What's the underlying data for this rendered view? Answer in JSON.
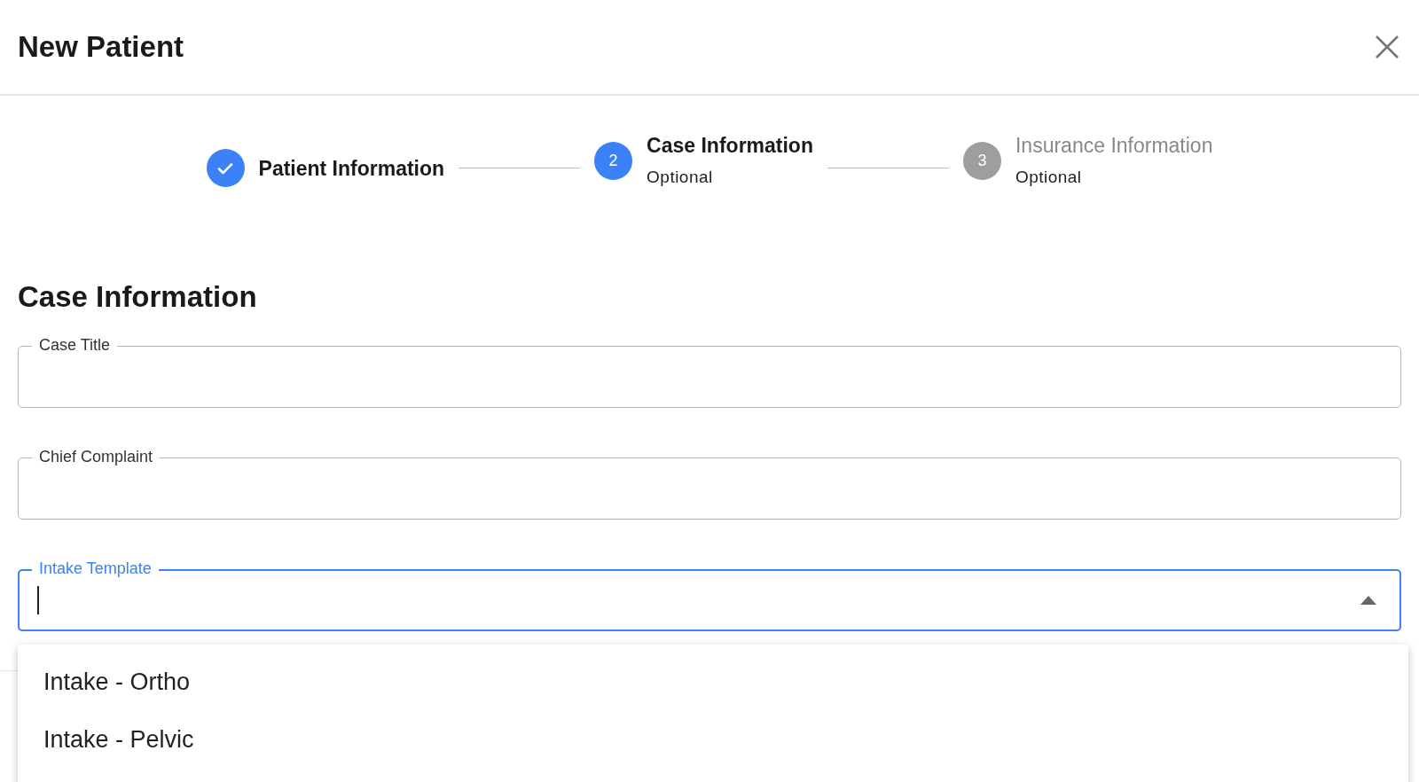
{
  "dialog": {
    "title": "New Patient"
  },
  "stepper": [
    {
      "label": "Patient Information",
      "completed": true,
      "selected": false
    },
    {
      "label": "Case Information",
      "number": "2",
      "caption": "Optional",
      "completed": false,
      "selected": true
    },
    {
      "label": "Insurance Information",
      "number": "3",
      "caption": "Optional",
      "completed": false,
      "selected": false
    }
  ],
  "section": {
    "heading": "Case Information"
  },
  "fields": [
    {
      "label": "Case Title",
      "kind": "text",
      "focused": false
    },
    {
      "label": "Chief Complaint",
      "kind": "text",
      "focused": false
    },
    {
      "label": "Intake Template",
      "kind": "select",
      "focused": true,
      "expanded": true
    }
  ],
  "dropdown": {
    "options": [
      "Intake - Ortho",
      "Intake - Pelvic"
    ]
  }
}
